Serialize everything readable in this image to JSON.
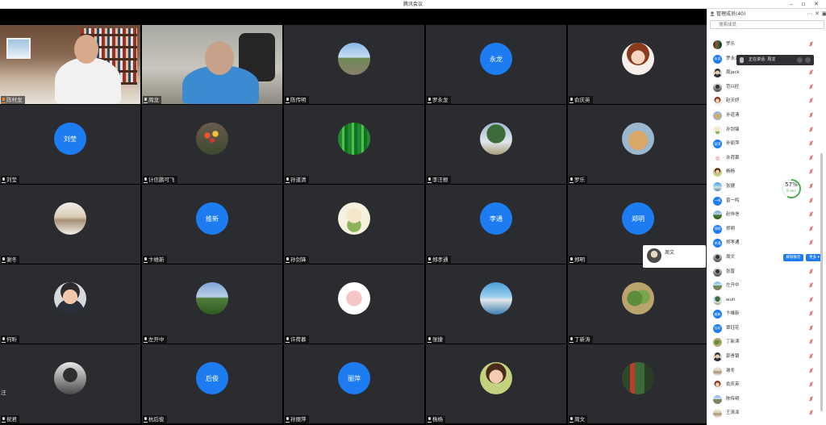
{
  "window": {
    "title": "腾讯会议"
  },
  "panel": {
    "title": "管理成员(40)",
    "search_placeholder": "搜索成员",
    "members": [
      {
        "name": "罗乐",
        "avatar_text": ""
      },
      {
        "name": "罗永龙",
        "avatar_text": "永龙"
      },
      {
        "name": "周jack",
        "avatar_text": ""
      },
      {
        "name": "范兴旺",
        "avatar_text": ""
      },
      {
        "name": "赵天妤",
        "avatar_text": ""
      },
      {
        "name": "孙道清",
        "avatar_text": ""
      },
      {
        "name": "孙剑锋",
        "avatar_text": ""
      },
      {
        "name": "孙丽萍",
        "avatar_text": "丽萍"
      },
      {
        "name": "许荷慕",
        "avatar_text": ""
      },
      {
        "name": "杨杨",
        "avatar_text": ""
      },
      {
        "name": "张捷",
        "avatar_text": ""
      },
      {
        "name": "曾一鸣",
        "avatar_text": "一鸣"
      },
      {
        "name": "赵伟信",
        "avatar_text": ""
      },
      {
        "name": "郑明",
        "avatar_text": "郑明"
      },
      {
        "name": "郑孝通",
        "avatar_text": "孝通"
      },
      {
        "name": "周文",
        "avatar_text": ""
      },
      {
        "name": "张晋",
        "avatar_text": ""
      },
      {
        "name": "左开中",
        "avatar_text": ""
      },
      {
        "name": "wuh",
        "avatar_text": ""
      },
      {
        "name": "卞维新",
        "avatar_text": "维新"
      },
      {
        "name": "覃钰花",
        "avatar_text": "钰花"
      },
      {
        "name": "丁新涛",
        "avatar_text": ""
      },
      {
        "name": "郭贵银",
        "avatar_text": ""
      },
      {
        "name": "谢冬",
        "avatar_text": ""
      },
      {
        "name": "俞庆英",
        "avatar_text": ""
      },
      {
        "name": "陈传明",
        "avatar_text": ""
      },
      {
        "name": "王清泽",
        "avatar_text": ""
      }
    ],
    "row_actions": {
      "unmute": "解除静音",
      "more": "更多 ▾"
    }
  },
  "tooltip": {
    "text": "正在讲话: 周龙"
  },
  "timer": {
    "percent": "57%",
    "seconds": "8 sec"
  },
  "float_card": {
    "name": "周文"
  },
  "tiles": [
    {
      "name": "陈村龙",
      "kind": "office",
      "mic": "orange"
    },
    {
      "name": "周龙",
      "kind": "office2",
      "mic": "white"
    },
    {
      "name": "陈传明",
      "kind": "img",
      "style": "av-road"
    },
    {
      "name": "罗永龙",
      "kind": "text",
      "text": "永龙"
    },
    {
      "name": "俞庆英",
      "kind": "img",
      "style": "av-girl"
    },
    {
      "name": "刘莹",
      "kind": "text",
      "text": "刘莹"
    },
    {
      "name": "计信鹏可飞",
      "kind": "img",
      "style": "av-tulip"
    },
    {
      "name": "孙道清",
      "kind": "img",
      "style": "av-bamboo"
    },
    {
      "name": "李汪根",
      "kind": "img",
      "style": "av-tree"
    },
    {
      "name": "罗乐",
      "kind": "img",
      "style": "av-cheetah"
    },
    {
      "name": "谢冬",
      "kind": "img",
      "style": "av-beige"
    },
    {
      "name": "卞维新",
      "kind": "text",
      "text": "维新"
    },
    {
      "name": "孙剑锋",
      "kind": "img",
      "style": "av-cartoon"
    },
    {
      "name": "郑孝通",
      "kind": "text",
      "text": "李通"
    },
    {
      "name": "郑明",
      "kind": "text",
      "text": "郑明"
    },
    {
      "name": "何昕",
      "kind": "img",
      "style": "av-man"
    },
    {
      "name": "左开中",
      "kind": "img",
      "style": "av-field"
    },
    {
      "name": "许荷慕",
      "kind": "img",
      "style": "av-pig"
    },
    {
      "name": "张捷",
      "kind": "img",
      "style": "av-boat"
    },
    {
      "name": "丁新涛",
      "kind": "img",
      "style": "av-plant"
    },
    {
      "name": "祝君",
      "kind": "img",
      "style": "av-dark",
      "extra": "汪"
    },
    {
      "name": "杭后俊",
      "kind": "text",
      "text": "后俊"
    },
    {
      "name": "孙丽萍",
      "kind": "text",
      "text": "丽萍"
    },
    {
      "name": "杨杨",
      "kind": "img",
      "style": "av-lady"
    },
    {
      "name": "周文",
      "kind": "img",
      "style": "av-street"
    }
  ],
  "colors": {
    "accent": "#1e7cf2",
    "tile_bg": "#2b2c2f",
    "muted_red": "#e05050",
    "speaking_orange": "#ff8a1e"
  }
}
